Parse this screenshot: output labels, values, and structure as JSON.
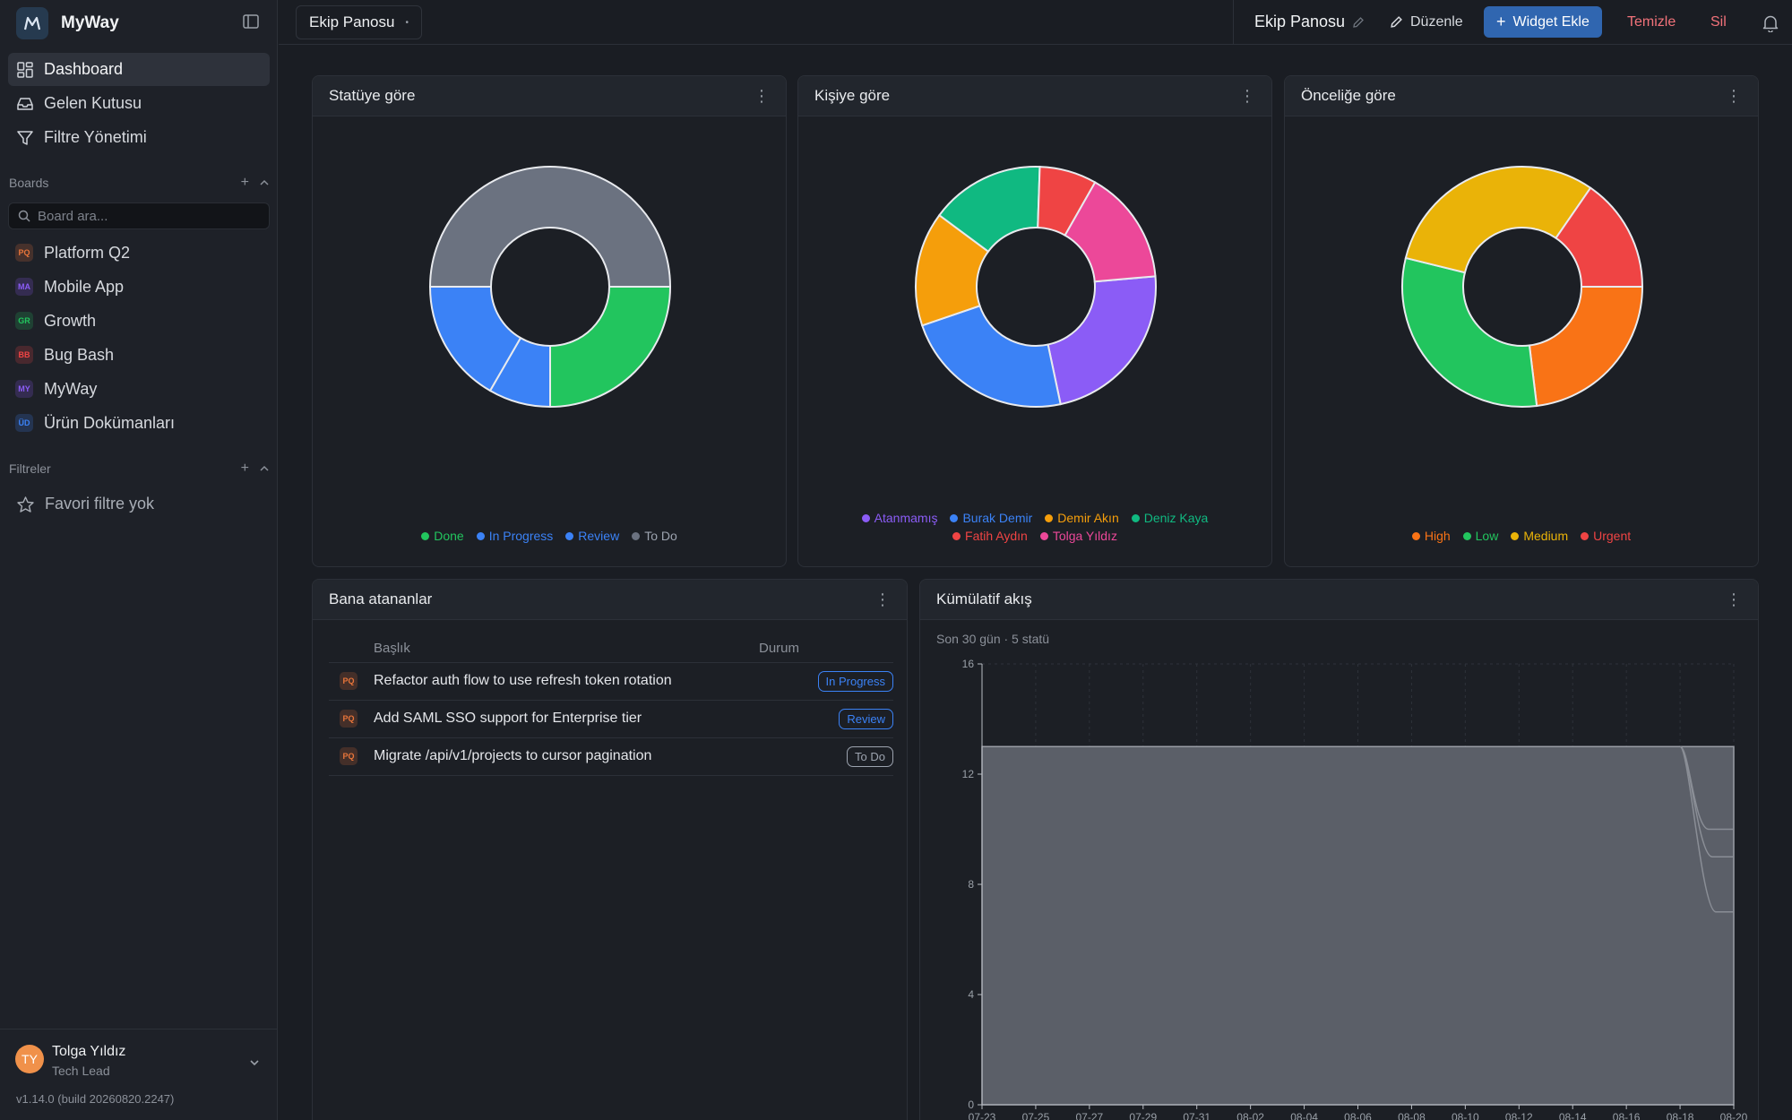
{
  "app": {
    "name": "MyWay"
  },
  "nav": [
    {
      "label": "Dashboard",
      "icon": "dashboard-icon",
      "active": true
    },
    {
      "label": "Gelen Kutusu",
      "icon": "inbox-icon",
      "active": false
    },
    {
      "label": "Filtre Yönetimi",
      "icon": "filter-icon",
      "active": false
    }
  ],
  "boards_section": {
    "title": "Boards",
    "search_placeholder": "Board ara..."
  },
  "boards": [
    {
      "code": "PQ",
      "label": "Platform Q2",
      "color": "#e8753a"
    },
    {
      "code": "MA",
      "label": "Mobile App",
      "color": "#8b5cf6"
    },
    {
      "code": "GR",
      "label": "Growth",
      "color": "#22c55e"
    },
    {
      "code": "BB",
      "label": "Bug Bash",
      "color": "#ef4444"
    },
    {
      "code": "MY",
      "label": "MyWay",
      "color": "#8b5cf6"
    },
    {
      "code": "ÜD",
      "label": "Ürün Dokümanları",
      "color": "#3b82f6"
    }
  ],
  "filters_section": {
    "title": "Filtreler",
    "empty": "Favori filtre yok"
  },
  "user": {
    "initials": "TY",
    "name": "Tolga Yıldız",
    "role": "Tech Lead",
    "version": "v1.14.0 (build 20260820.2247)"
  },
  "topbar": {
    "board_switch": "Ekip Panosu",
    "title": "Ekip Panosu",
    "edit": "Düzenle",
    "add_widget": "Widget Ekle",
    "clear": "Temizle",
    "delete": "Sil"
  },
  "widgets": {
    "status": {
      "title": "Statüye göre"
    },
    "person": {
      "title": "Kişiye göre"
    },
    "priority": {
      "title": "Önceliğe göre"
    },
    "assigned": {
      "title": "Bana atananlar",
      "headers": {
        "title": "Başlık",
        "status": "Durum"
      },
      "rows": [
        {
          "code": "PQ",
          "title": "Refactor auth flow to use refresh token rotation",
          "status": "In Progress",
          "color": "#3b82f6"
        },
        {
          "code": "PQ",
          "title": "Add SAML SSO support for Enterprise tier",
          "status": "Review",
          "color": "#3b82f6"
        },
        {
          "code": "PQ",
          "title": "Migrate /api/v1/projects to cursor pagination",
          "status": "To Do",
          "color": "#9ca3af"
        }
      ]
    },
    "cumulative": {
      "title": "Kümülatif akış",
      "subtitle": "Son 30 gün · 5 statü"
    }
  },
  "chart_data": [
    {
      "type": "pie",
      "title": "Statüye göre",
      "labels": [
        "Done",
        "In Progress",
        "Review",
        "To Do"
      ],
      "values": [
        3,
        1,
        2,
        6
      ],
      "colors": [
        "#22c55e",
        "#3b82f6",
        "#3b82f6",
        "#6b7280"
      ]
    },
    {
      "type": "pie",
      "title": "Kişiye göre",
      "labels": [
        "Atanmamış",
        "Burak Demir",
        "Demir Akın",
        "Deniz Kaya",
        "Fatih Aydın",
        "Tolga Yıldız"
      ],
      "values": [
        3,
        3,
        2,
        2,
        1,
        2
      ],
      "colors": [
        "#8b5cf6",
        "#3b82f6",
        "#f59e0b",
        "#10b981",
        "#ef4444",
        "#ec4899"
      ]
    },
    {
      "type": "pie",
      "title": "Önceliğe göre",
      "labels": [
        "High",
        "Low",
        "Medium",
        "Urgent"
      ],
      "values": [
        3,
        4,
        4,
        2
      ],
      "colors": [
        "#f97316",
        "#22c55e",
        "#eab308",
        "#ef4444"
      ]
    },
    {
      "type": "area",
      "title": "Kümülatif akış",
      "x": [
        "07-23",
        "07-25",
        "07-27",
        "07-29",
        "07-31",
        "08-02",
        "08-04",
        "08-06",
        "08-08",
        "08-10",
        "08-12",
        "08-14",
        "08-16",
        "08-18",
        "08-20"
      ],
      "yticks": [
        0,
        4,
        8,
        12,
        16
      ],
      "ylim": [
        0,
        16
      ],
      "total": 13,
      "end_levels": [
        10,
        9,
        7
      ]
    }
  ]
}
